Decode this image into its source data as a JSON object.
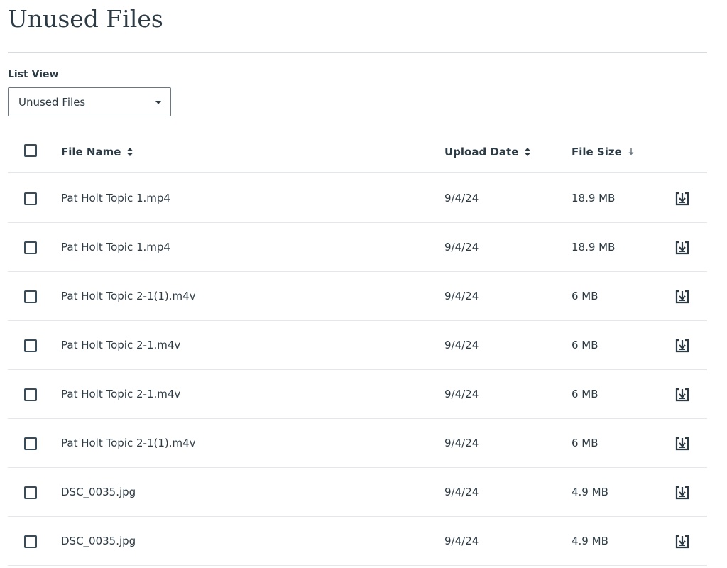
{
  "page": {
    "title": "Unused Files"
  },
  "list_view": {
    "label": "List View",
    "selected": "Unused Files"
  },
  "table": {
    "columns": [
      {
        "label": "File Name",
        "sort": "unsorted"
      },
      {
        "label": "Upload Date",
        "sort": "unsorted"
      },
      {
        "label": "File Size",
        "sort": "descending"
      }
    ],
    "rows": [
      {
        "name": "Pat Holt Topic 1.mp4",
        "date": "9/4/24",
        "size": "18.9 MB"
      },
      {
        "name": "Pat Holt Topic 1.mp4",
        "date": "9/4/24",
        "size": "18.9 MB"
      },
      {
        "name": "Pat Holt Topic 2-1(1).m4v",
        "date": "9/4/24",
        "size": "6 MB"
      },
      {
        "name": "Pat Holt Topic 2-1.m4v",
        "date": "9/4/24",
        "size": "6 MB"
      },
      {
        "name": "Pat Holt Topic 2-1.m4v",
        "date": "9/4/24",
        "size": "6 MB"
      },
      {
        "name": "Pat Holt Topic 2-1(1).m4v",
        "date": "9/4/24",
        "size": "6 MB"
      },
      {
        "name": "DSC_0035.jpg",
        "date": "9/4/24",
        "size": "4.9 MB"
      },
      {
        "name": "DSC_0035.jpg",
        "date": "9/4/24",
        "size": "4.9 MB"
      }
    ]
  },
  "icons": {
    "sort": "sort-updown-icon",
    "sort_active": "sort-descending-icon",
    "download": "download-icon",
    "caret": "caret-down-icon"
  },
  "colors": {
    "text": "#2d3b45",
    "divider": "#e4e6e9",
    "border": "#6b7780"
  }
}
